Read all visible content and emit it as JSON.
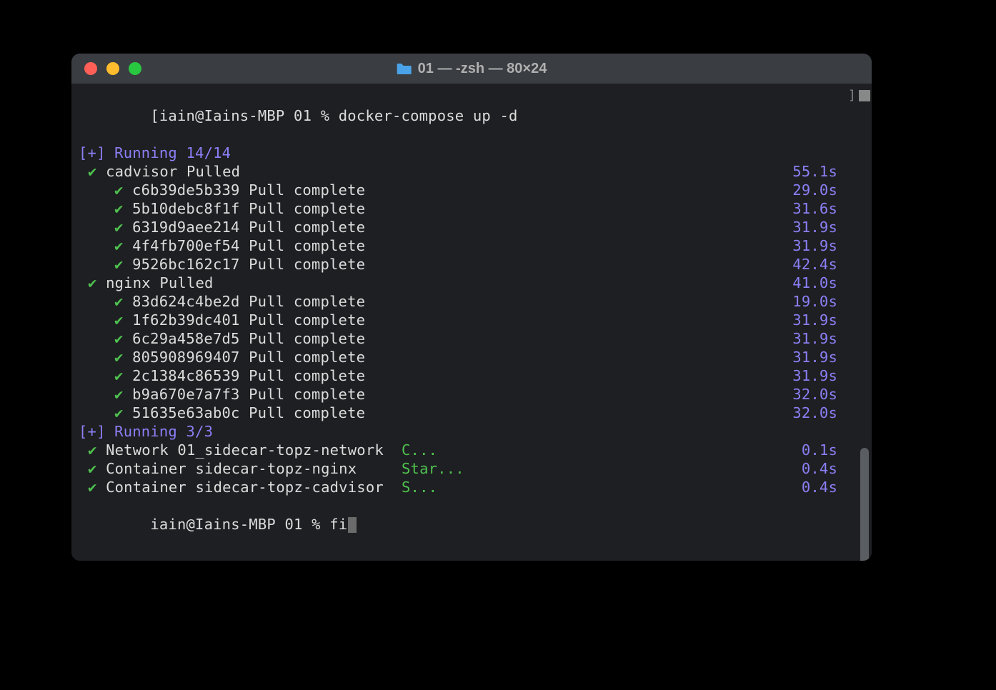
{
  "window": {
    "title": "01 — -zsh — 80×24"
  },
  "prompt": {
    "line1_open": "[",
    "line1_prompt": "iain@Iains-MBP 01 % ",
    "line1_cmd": "docker-compose up -d",
    "line1_close": "]"
  },
  "pull_header": "[+] Running 14/14",
  "pull_items": [
    {
      "indent": 1,
      "text": "cadvisor Pulled",
      "time": "55.1s"
    },
    {
      "indent": 2,
      "text": "c6b39de5b339 Pull complete",
      "time": "29.0s"
    },
    {
      "indent": 2,
      "text": "5b10debc8f1f Pull complete",
      "time": "31.6s"
    },
    {
      "indent": 2,
      "text": "6319d9aee214 Pull complete",
      "time": "31.9s"
    },
    {
      "indent": 2,
      "text": "4f4fb700ef54 Pull complete",
      "time": "31.9s"
    },
    {
      "indent": 2,
      "text": "9526bc162c17 Pull complete",
      "time": "42.4s"
    },
    {
      "indent": 1,
      "text": "nginx Pulled",
      "time": "41.0s"
    },
    {
      "indent": 2,
      "text": "83d624c4be2d Pull complete",
      "time": "19.0s"
    },
    {
      "indent": 2,
      "text": "1f62b39dc401 Pull complete",
      "time": "31.9s"
    },
    {
      "indent": 2,
      "text": "6c29a458e7d5 Pull complete",
      "time": "31.9s"
    },
    {
      "indent": 2,
      "text": "805908969407 Pull complete",
      "time": "31.9s"
    },
    {
      "indent": 2,
      "text": "2c1384c86539 Pull complete",
      "time": "31.9s"
    },
    {
      "indent": 2,
      "text": "b9a670e7a7f3 Pull complete",
      "time": "32.0s"
    },
    {
      "indent": 2,
      "text": "51635e63ab0c Pull complete",
      "time": "32.0s"
    }
  ],
  "run_header": "[+] Running 3/3",
  "run_items": [
    {
      "text": "Network 01_sidecar-topz-network",
      "status": "C...",
      "time": "0.1s"
    },
    {
      "text": "Container sidecar-topz-nginx",
      "status": "Star...",
      "time": "0.4s"
    },
    {
      "text": "Container sidecar-topz-cadvisor",
      "status": "S...",
      "time": "0.4s"
    }
  ],
  "prompt2": {
    "prompt": "iain@Iains-MBP 01 % ",
    "typed": "fi"
  },
  "colors": {
    "purple": "#8b7ff5",
    "green": "#4fc24f",
    "bg": "#1e1f22",
    "titlebar": "#3a3d41"
  }
}
